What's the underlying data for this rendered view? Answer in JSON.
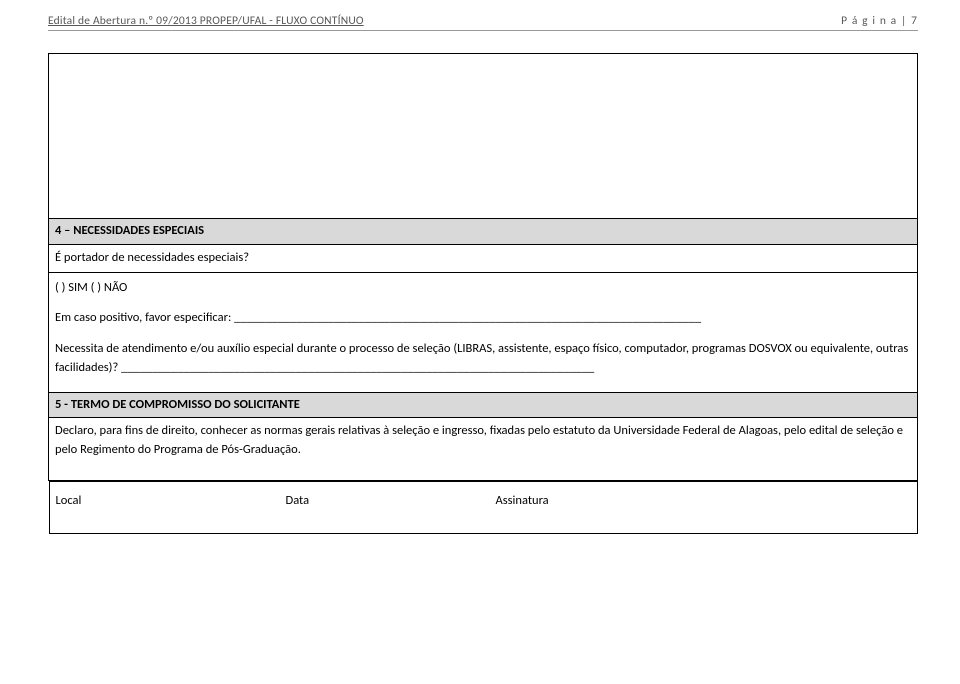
{
  "header": {
    "left": "Edital de Abertura n.º 09/2013 PROPEP/UFAL - FLUXO CONTÍNUO",
    "right": "P á g i n a  | 7"
  },
  "section4": {
    "title": "4 – NECESSIDADES ESPECIAIS",
    "q1": "É portador de necessidades especiais?",
    "opts": "(   ) SIM       (   ) NÃO",
    "spec_label": "Em caso positivo, favor especificar: ___________________________________________________________________________",
    "desc": "Necessita de atendimento e/ou auxílio especial durante o processo de seleção (LIBRAS, assistente, espaço físico, computador, programas DOSVOX ou equivalente, outras facilidades)? ____________________________________________________________________________"
  },
  "section5": {
    "title": "5 - TERMO DE COMPROMISSO DO SOLICITANTE",
    "decl": "Declaro, para fins de direito, conhecer as normas gerais relativas à seleção e ingresso, fixadas pelo estatuto da Universidade Federal de Alagoas, pelo edital de seleção e pelo Regimento do Programa de Pós-Graduação."
  },
  "sig": {
    "local": "Local",
    "data": "Data",
    "assinatura": "Assinatura"
  }
}
